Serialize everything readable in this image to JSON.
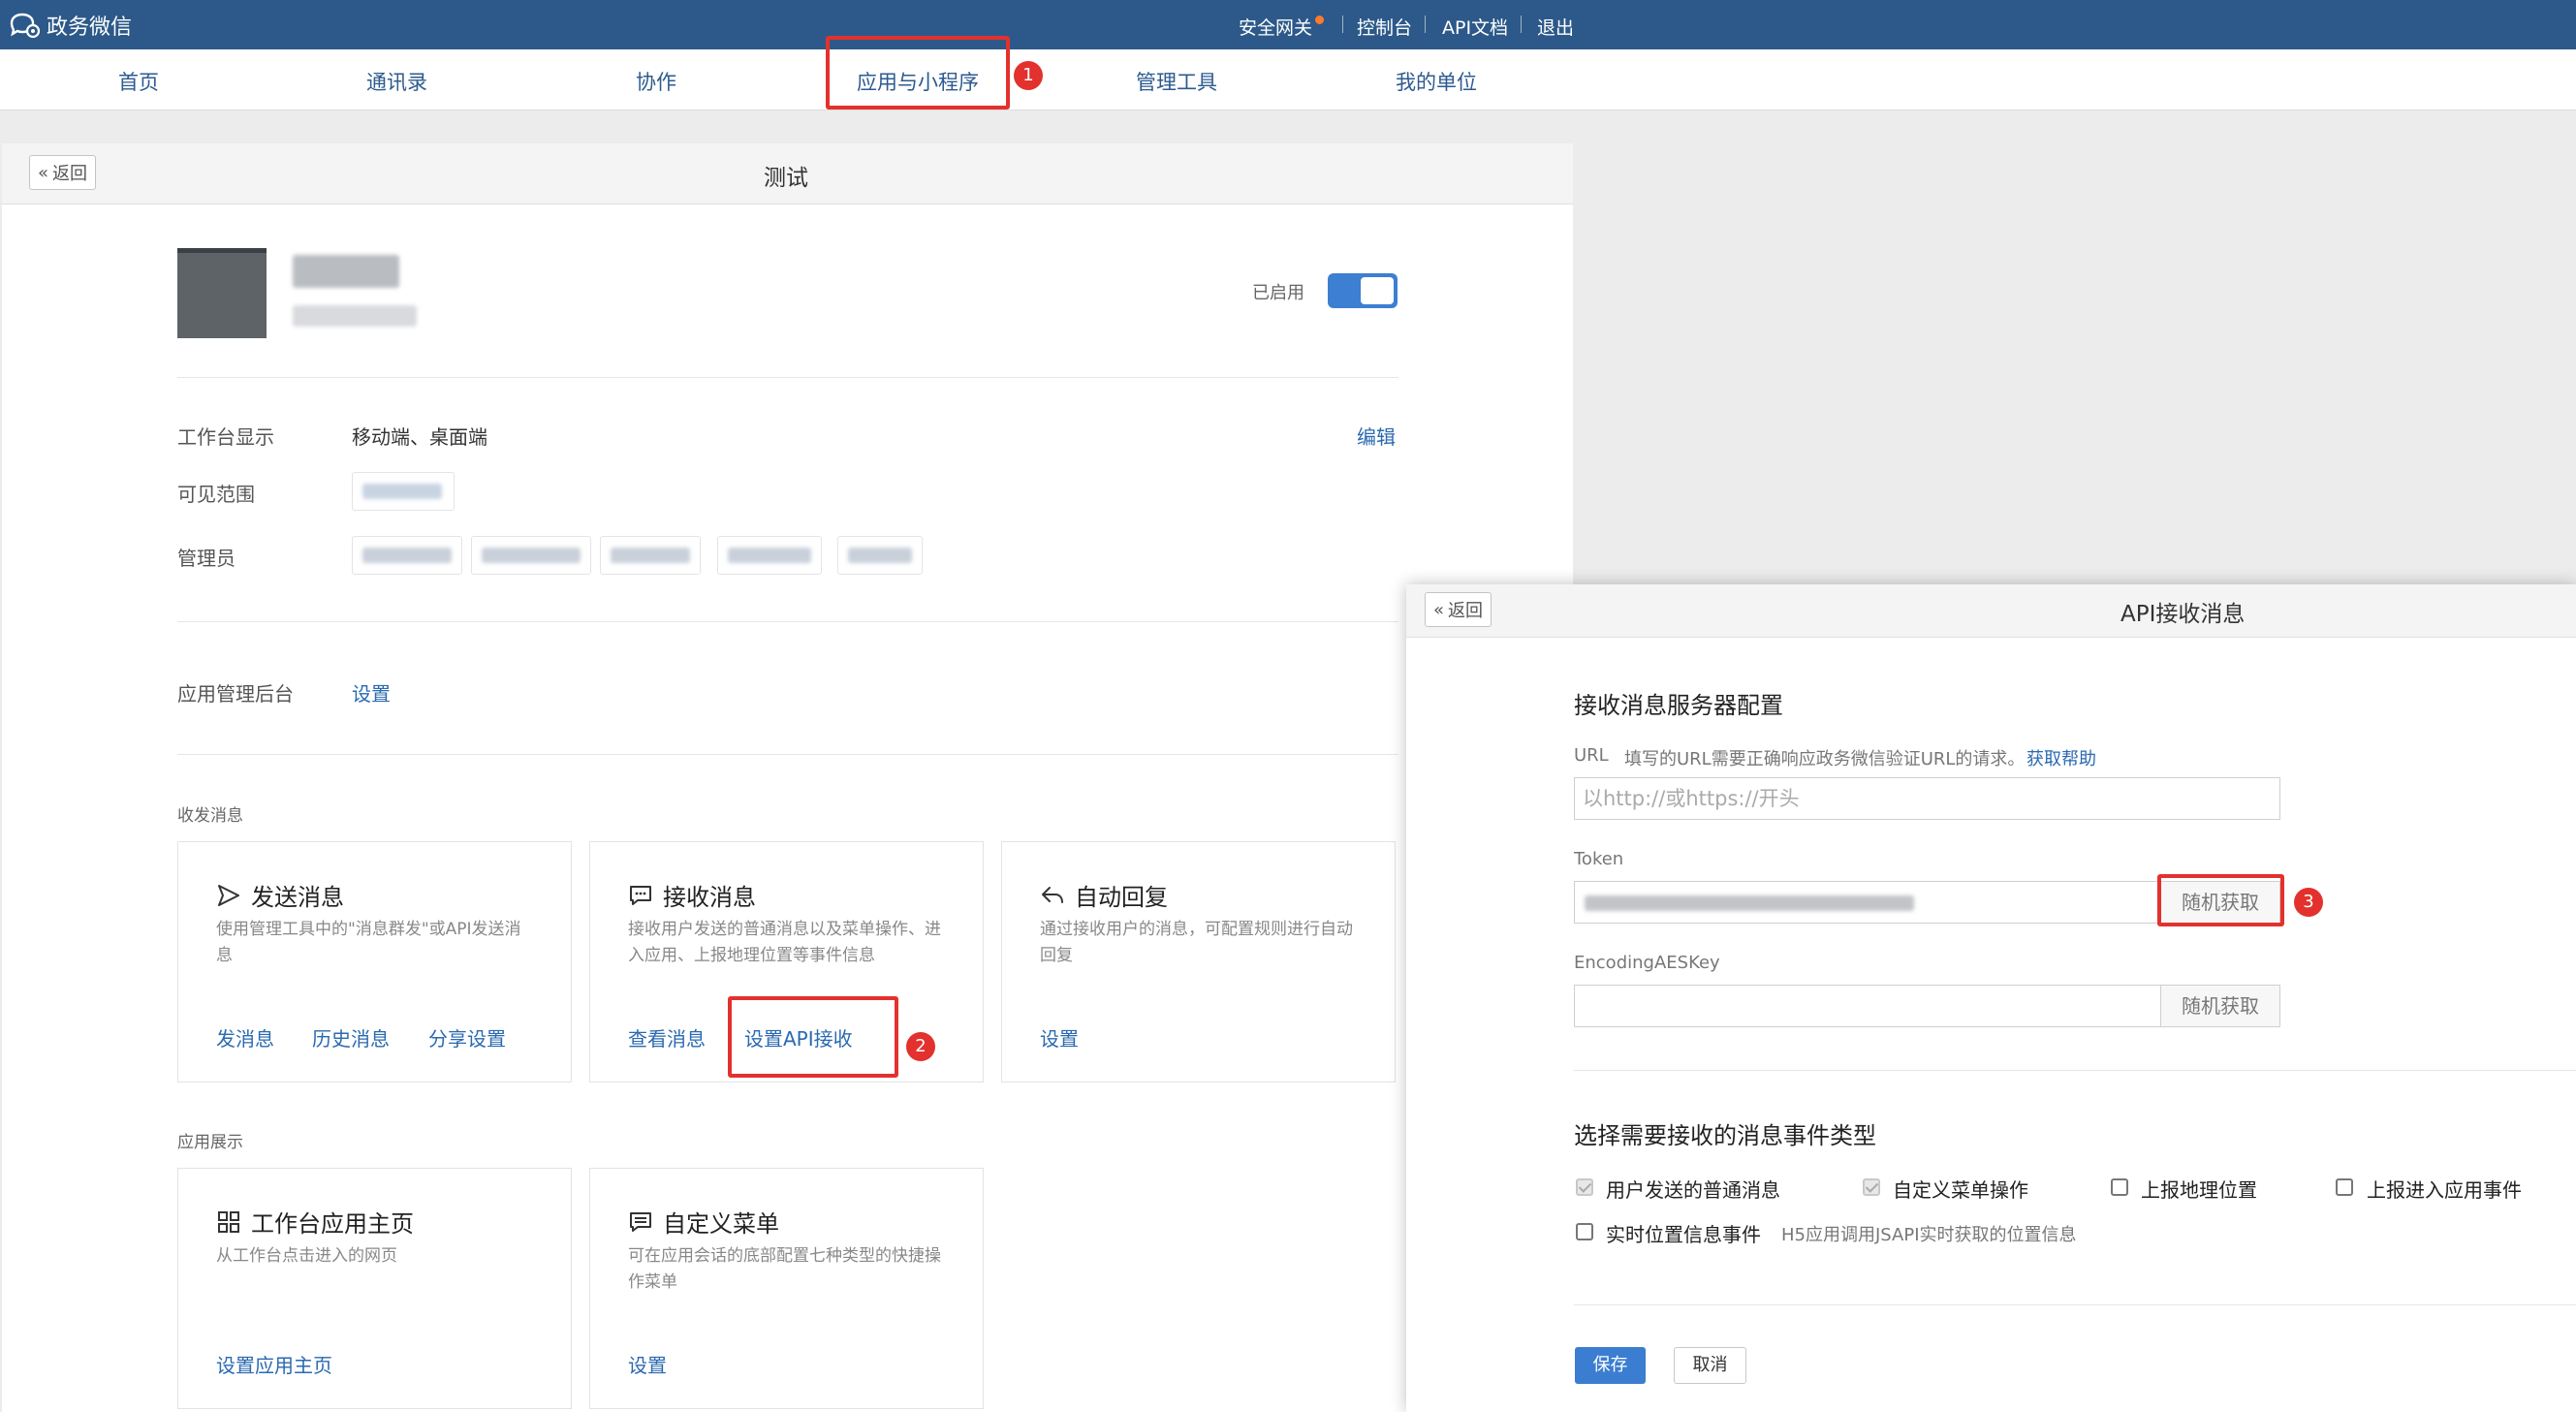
{
  "app": {
    "title": "政务微信",
    "top_links": [
      "安全网关",
      "控制台",
      "API文档",
      "退出"
    ]
  },
  "nav": {
    "items": [
      "首页",
      "通讯录",
      "协作",
      "应用与小程序",
      "管理工具",
      "我的单位"
    ],
    "active_index": 3
  },
  "annotations": {
    "badge1": "1",
    "badge2": "2",
    "badge3": "3",
    "highlight_color": "#e3312d"
  },
  "main": {
    "back_label": "返回",
    "title": "测试",
    "status_label": "已启用",
    "status_enabled": true,
    "rows": {
      "workbench_label": "工作台显示",
      "workbench_value": "移动端、桌面端",
      "edit_label": "编辑",
      "scope_label": "可见范围",
      "admin_label": "管理员",
      "backend_label": "应用管理后台",
      "backend_link": "设置"
    },
    "section_messages": "收发消息",
    "section_display": "应用展示",
    "cards": [
      {
        "title": "发送消息",
        "desc": "使用管理工具中的\"消息群发\"或API发送消息",
        "links": [
          "发消息",
          "历史消息",
          "分享设置"
        ]
      },
      {
        "title": "接收消息",
        "desc": "接收用户发送的普通消息以及菜单操作、进入应用、上报地理位置等事件信息",
        "links": [
          "查看消息",
          "设置API接收"
        ]
      },
      {
        "title": "自动回复",
        "desc": "通过接收用户的消息，可配置规则进行自动回复",
        "links": [
          "设置"
        ]
      },
      {
        "title": "工作台应用主页",
        "desc": "从工作台点击进入的网页",
        "links": [
          "设置应用主页"
        ]
      },
      {
        "title": "自定义菜单",
        "desc": "可在应用会话的底部配置七种类型的快捷操作菜单",
        "links": [
          "设置"
        ]
      }
    ]
  },
  "dialog": {
    "back_label": "返回",
    "title": "API接收消息",
    "server_section": "接收消息服务器配置",
    "url_label": "URL",
    "url_hint": "填写的URL需要正确响应政务微信验证URL的请求。",
    "url_help": "获取帮助",
    "url_placeholder": "以http://或https://开头",
    "token_label": "Token",
    "token_button": "随机获取",
    "aes_label": "EncodingAESKey",
    "aes_button": "随机获取",
    "events_section": "选择需要接收的消息事件类型",
    "events": [
      {
        "label": "用户发送的普通消息",
        "checked": true
      },
      {
        "label": "自定义菜单操作",
        "checked": true
      },
      {
        "label": "上报地理位置",
        "checked": false
      },
      {
        "label": "上报进入应用事件",
        "checked": false
      },
      {
        "label": "实时位置信息事件",
        "checked": false
      }
    ],
    "realtime_hint": "H5应用调用JSAPI实时获取的位置信息",
    "save_label": "保存",
    "cancel_label": "取消"
  }
}
